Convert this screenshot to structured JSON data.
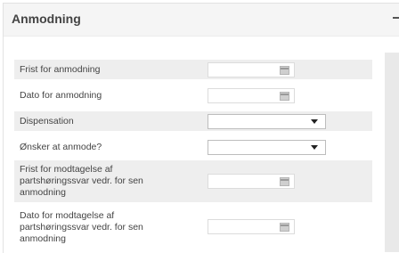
{
  "panel": {
    "title": "Anmodning"
  },
  "fields": [
    {
      "label": "Frist for anmodning",
      "type": "date",
      "value": ""
    },
    {
      "label": "Dato for anmodning",
      "type": "date",
      "value": ""
    },
    {
      "label": "Dispensation",
      "type": "select",
      "value": ""
    },
    {
      "label": "Ønsker at anmode?",
      "type": "select",
      "value": ""
    },
    {
      "label": "Frist for modtagelse af partshøringssvar vedr. for sen anmodning",
      "type": "date",
      "value": ""
    },
    {
      "label": "Dato for modtagelse af partshøringssvar vedr. for sen anmodning",
      "type": "date",
      "value": ""
    }
  ],
  "icons": {
    "calendar": "calendar-icon",
    "dropdown": "chevron-down-icon",
    "collapse": "minus-icon"
  },
  "colors": {
    "row_shaded": "#eeeeee",
    "header_bg": "#f5f5f5"
  }
}
